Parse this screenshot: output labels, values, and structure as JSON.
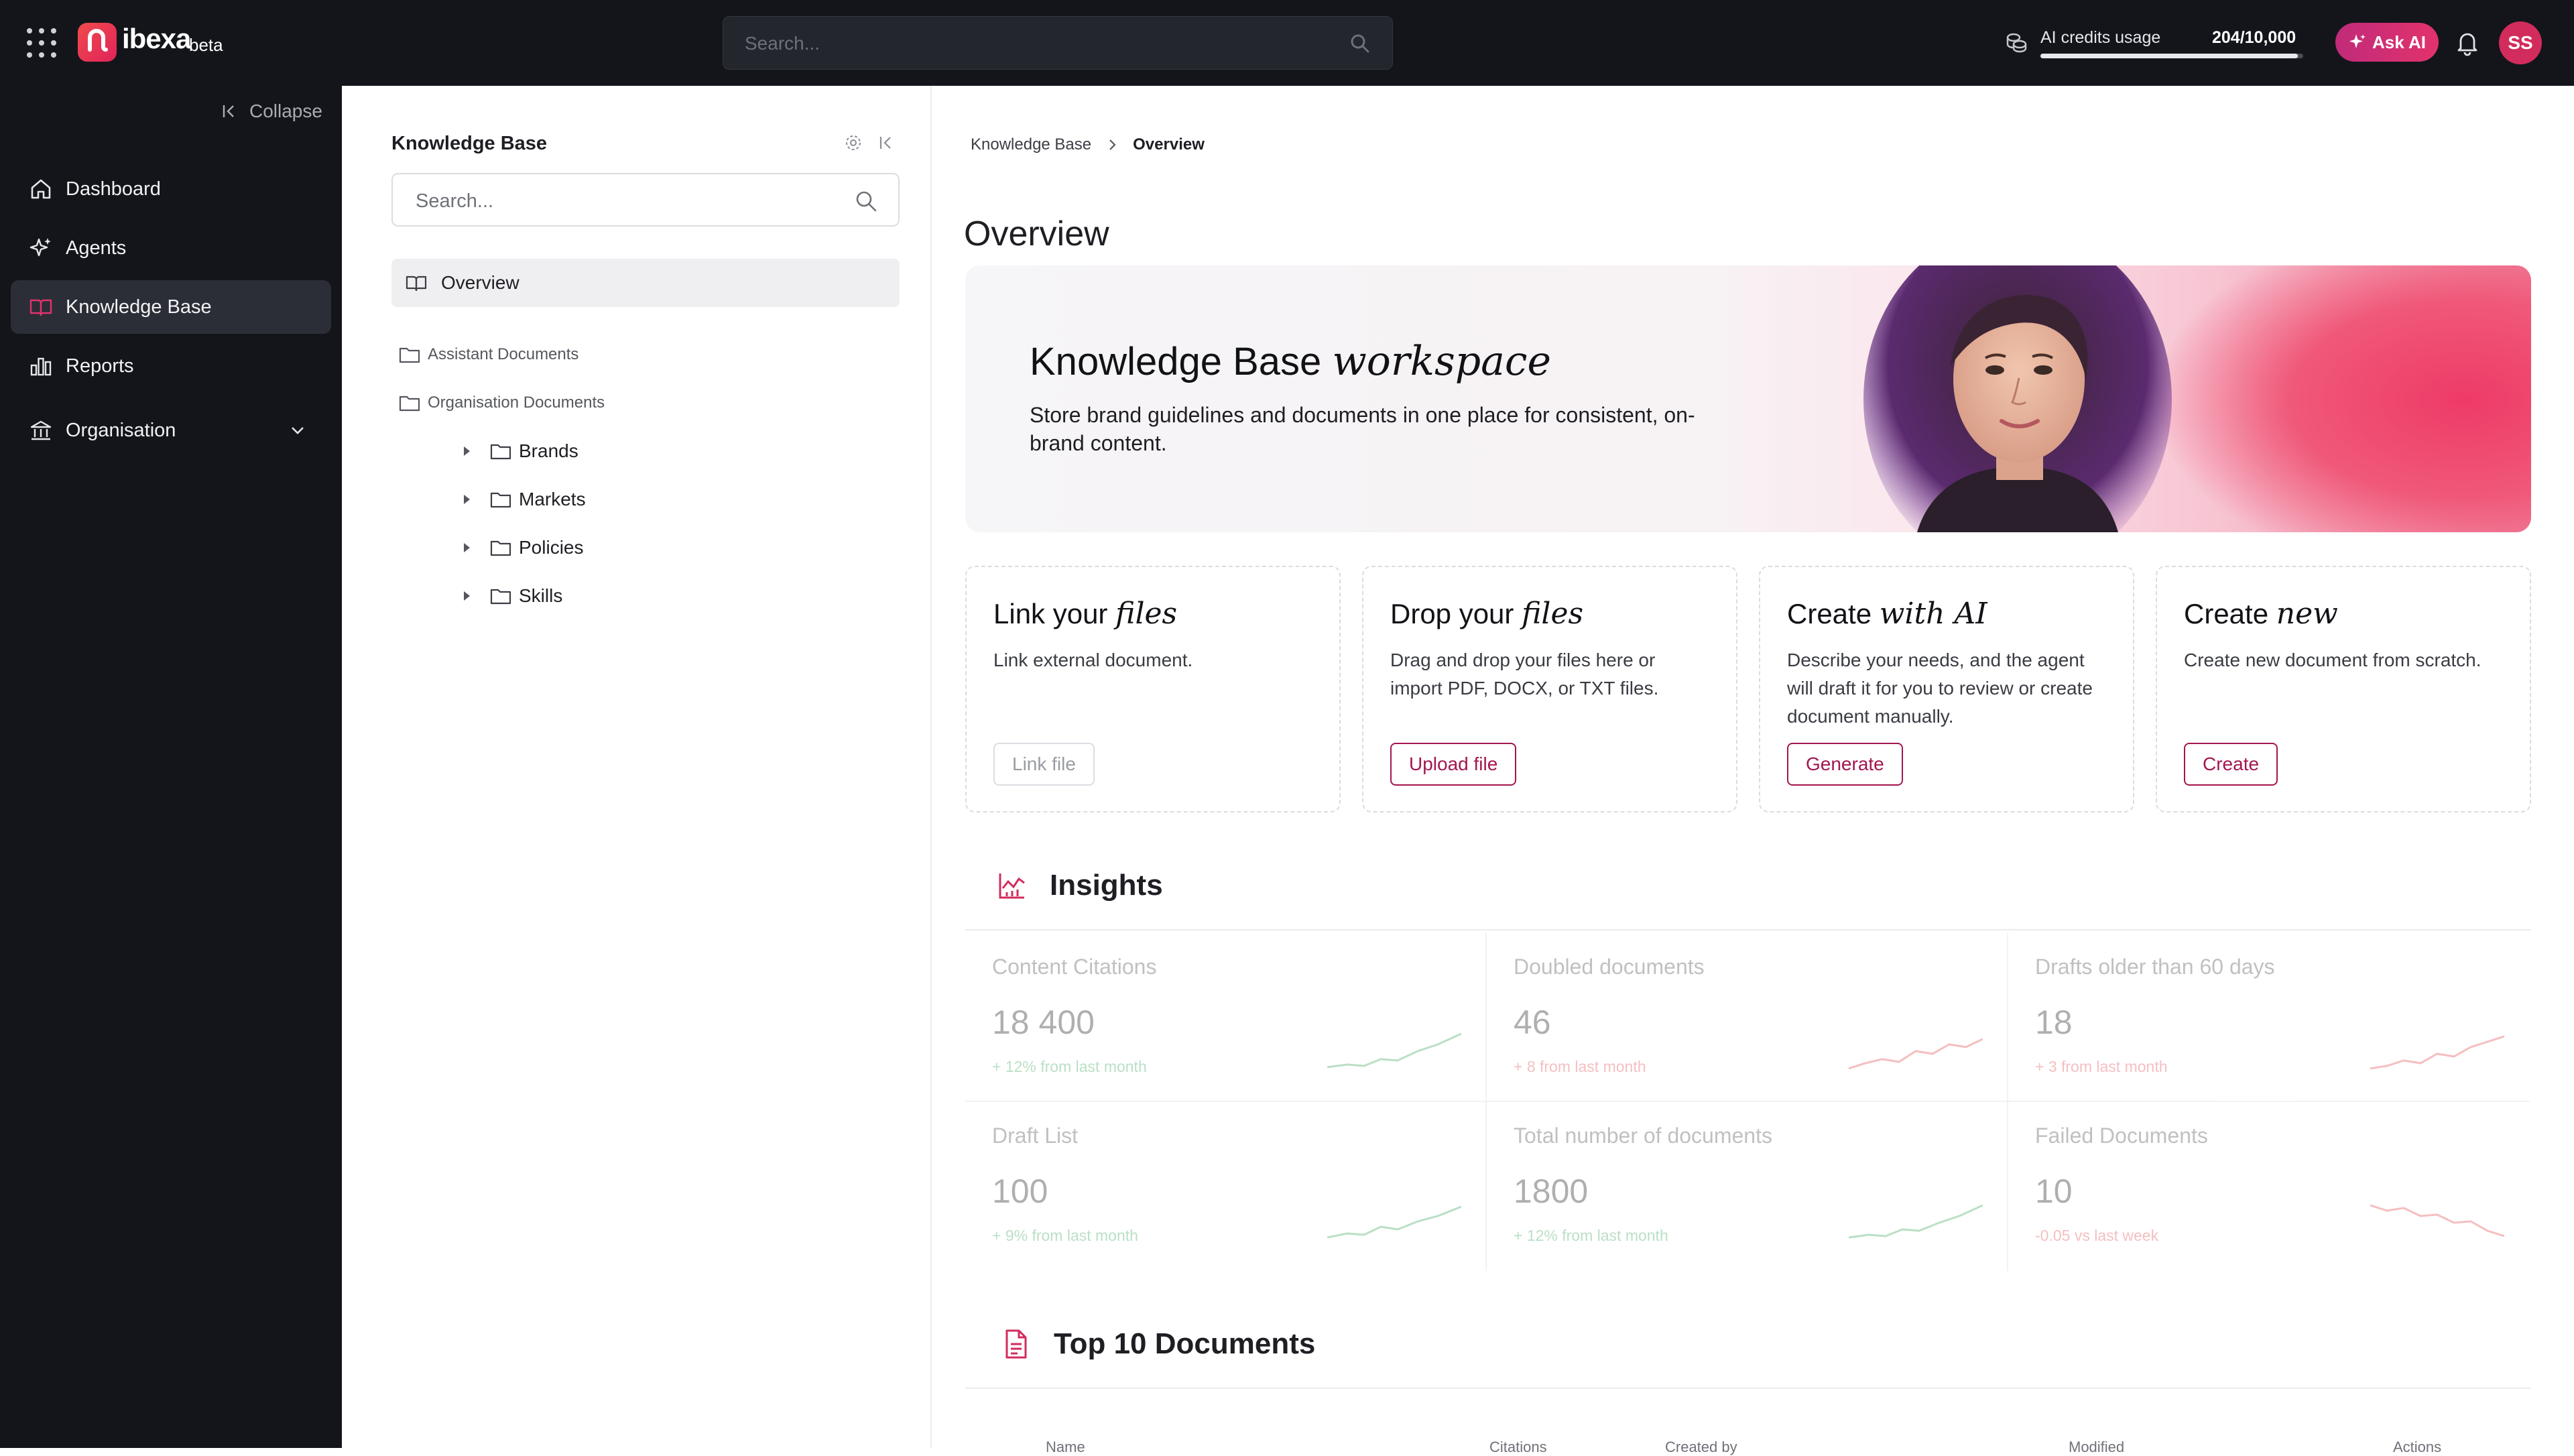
{
  "brand": {
    "name": "ibexa",
    "tag": "beta",
    "accent": "#e0235a"
  },
  "topbar": {
    "search_placeholder": "Search...",
    "credits": {
      "label": "AI credits usage",
      "value": "204/10,000",
      "used_fraction": 0.98
    },
    "ask_ai_label": "Ask AI",
    "user_initials": "SS"
  },
  "sidebar": {
    "collapse_label": "Collapse",
    "items": [
      {
        "label": "Dashboard",
        "icon": "home-icon"
      },
      {
        "label": "Agents",
        "icon": "sparkle-icon"
      },
      {
        "label": "Knowledge Base",
        "icon": "book-icon",
        "active": true
      },
      {
        "label": "Reports",
        "icon": "bar-chart-icon"
      },
      {
        "label": "Organisation",
        "icon": "building-icon"
      }
    ]
  },
  "kpanel": {
    "title": "Knowledge Base",
    "search_placeholder": "Search...",
    "overview_label": "Overview",
    "tree": [
      {
        "label": "Assistant Documents"
      },
      {
        "label": "Organisation Documents"
      }
    ],
    "subfolders": [
      {
        "label": "Brands"
      },
      {
        "label": "Markets"
      },
      {
        "label": "Policies"
      },
      {
        "label": "Skills"
      }
    ]
  },
  "breadcrumb": {
    "root": "Knowledge Base",
    "current": "Overview"
  },
  "page_title": "Overview",
  "hero": {
    "title_main": "Knowledge Base",
    "title_accent": "workspace",
    "description": "Store brand guidelines and documents in one place for consistent, on-brand content."
  },
  "cards": [
    {
      "title_main": "Link your",
      "title_accent": "files",
      "description": "Link external document.",
      "button": "Link file",
      "disabled": true
    },
    {
      "title_main": "Drop your",
      "title_accent": "files",
      "description": "Drag and drop your files here or import PDF, DOCX, or TXT files.",
      "button": "Upload file"
    },
    {
      "title_main": "Create",
      "title_accent": "with AI",
      "description": "Describe your needs, and the agent will draft it for you to review or create document manually.",
      "button": "Generate"
    },
    {
      "title_main": "Create",
      "title_accent": "new",
      "description": "Create new document from scratch.",
      "button": "Create"
    }
  ],
  "insights": {
    "title": "Insights",
    "stats": [
      {
        "label": "Content Citations",
        "value": "18 400",
        "delta": "+ 12% from last month",
        "trend": "up",
        "color": "#3ba55c"
      },
      {
        "label": "Doubled documents",
        "value": "46",
        "delta": "+ 8 from last month",
        "trend": "up",
        "color": "#e5484d"
      },
      {
        "label": "Drafts older than 60 days",
        "value": "18",
        "delta": "+ 3 from last month",
        "trend": "up",
        "color": "#e5484d"
      },
      {
        "label": "Draft List",
        "value": "100",
        "delta": "+ 9% from last month",
        "trend": "up",
        "color": "#3ba55c"
      },
      {
        "label": "Total number of documents",
        "value": "1800",
        "delta": "+ 12% from last month",
        "trend": "up",
        "color": "#3ba55c"
      },
      {
        "label": "Failed Documents",
        "value": "10",
        "delta": "-0.05 vs last week",
        "trend": "down",
        "color": "#e5484d"
      }
    ]
  },
  "top_docs": {
    "title": "Top 10 Documents",
    "columns": [
      "Name",
      "Citations",
      "Created by",
      "Modified",
      "Actions"
    ]
  }
}
